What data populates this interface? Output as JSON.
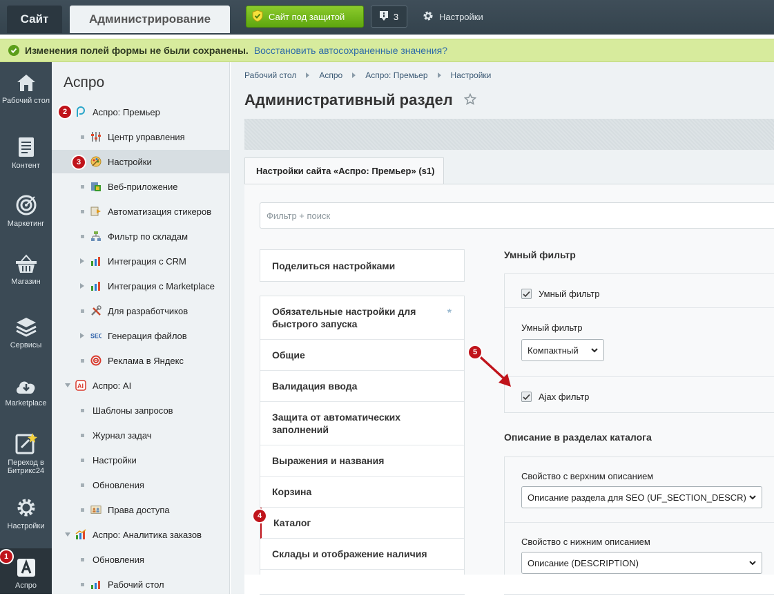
{
  "topbar": {
    "tab_site": "Сайт",
    "tab_admin": "Администрирование",
    "protect_label": "Сайт под защитой",
    "notifications_count": "3",
    "settings_label": "Настройки"
  },
  "warning": {
    "text": "Изменения полей формы не были сохранены.",
    "link": "Восстановить автосохраненные значения?"
  },
  "iconbar": {
    "items": [
      {
        "label": "Рабочий стол",
        "icon": "home-icon"
      },
      {
        "label": "Контент",
        "icon": "document-icon"
      },
      {
        "label": "Маркетинг",
        "icon": "target-icon"
      },
      {
        "label": "Магазин",
        "icon": "basket-icon"
      },
      {
        "label": "Сервисы",
        "icon": "layers-icon"
      },
      {
        "label": "Marketplace",
        "icon": "cloud-download-icon"
      },
      {
        "label": "Переход в Битрикс24",
        "icon": "bitrix24-icon"
      },
      {
        "label": "Настройки",
        "icon": "gear-icon"
      },
      {
        "label": "Аспро",
        "icon": "aspro-icon"
      }
    ]
  },
  "menu": {
    "title": "Аспро",
    "items": [
      {
        "label": "Аспро: Премьер"
      },
      {
        "label": "Центр управления"
      },
      {
        "label": "Настройки"
      },
      {
        "label": "Веб-приложение"
      },
      {
        "label": "Автоматизация стикеров"
      },
      {
        "label": "Фильтр по складам"
      },
      {
        "label": "Интеграция с CRM"
      },
      {
        "label": "Интеграция с Marketplace"
      },
      {
        "label": "Для разработчиков"
      },
      {
        "label": "Генерация файлов"
      },
      {
        "label": "Реклама в Яндекс"
      },
      {
        "label": "Аспро: AI"
      },
      {
        "label": "Шаблоны запросов"
      },
      {
        "label": "Журнал задач"
      },
      {
        "label": "Настройки"
      },
      {
        "label": "Обновления"
      },
      {
        "label": "Права доступа"
      },
      {
        "label": "Аспро: Аналитика заказов"
      },
      {
        "label": "Обновления"
      },
      {
        "label": "Рабочий стол"
      }
    ]
  },
  "badges": [
    "1",
    "2",
    "3",
    "4",
    "5"
  ],
  "breadcrumb": [
    "Рабочий стол",
    "Аспро",
    "Аспро: Премьер",
    "Настройки"
  ],
  "page_title": "Административный раздел",
  "site_tab": "Настройки сайта «Аспро: Премьер» (s1)",
  "filter_placeholder": "Фильтр + поиск",
  "share_label": "Поделиться настройками",
  "categories": [
    "Обязательные настройки для быстрого запуска",
    "Общие",
    "Валидация ввода",
    "Защита от автоматических заполнений",
    "Выражения и названия",
    "Корзина",
    "Каталог",
    "Склады и отображение наличия"
  ],
  "smart_filter": {
    "title": "Умный фильтр",
    "checkbox1": "Умный фильтр",
    "select_label": "Умный фильтр",
    "select_value": "Компактный",
    "checkbox2": "Ajax фильтр"
  },
  "description": {
    "title": "Описание в разделах каталога",
    "top_label": "Свойство с верхним описанием",
    "top_value": "Описание раздела для SEO (UF_SECTION_DESCR)",
    "bottom_label": "Свойство с нижним описанием",
    "bottom_value": "Описание (DESCRIPTION)"
  },
  "colors": {
    "topbar": "#3b4a55",
    "accent_green": "#6db41c",
    "badge_red": "#c0141b",
    "link": "#2d6aa8"
  }
}
